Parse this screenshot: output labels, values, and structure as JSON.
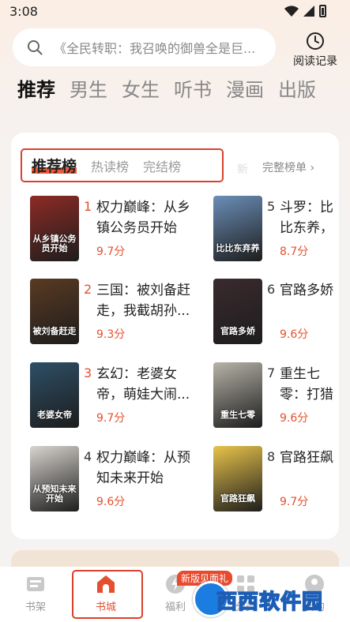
{
  "status": {
    "time": "3:08"
  },
  "search": {
    "text": "《全民转职：我召唤的御兽全是巨..."
  },
  "history": {
    "label": "阅读记录"
  },
  "categories": [
    "推荐",
    "男生",
    "女生",
    "听书",
    "漫画",
    "出版"
  ],
  "ranking": {
    "tabs": [
      "推荐榜",
      "热读榜",
      "完结榜"
    ],
    "full_list_label": "完整榜单",
    "books": [
      {
        "rank": "1",
        "title": "权力巅峰：从乡镇公务员开始",
        "score": "9.7分",
        "cover_text": "从乡镇公务员开始",
        "cover_color": "#8e2b25"
      },
      {
        "rank": "2",
        "title": "三国：被刘备赶走，我截胡孙...",
        "score": "9.3分",
        "cover_text": "被刘备赶走",
        "cover_color": "#5a3a22"
      },
      {
        "rank": "3",
        "title": "玄幻：老婆女帝，萌娃大闹...",
        "score": "9.7分",
        "cover_text": "老婆女帝",
        "cover_color": "#2e4f66"
      },
      {
        "rank": "4",
        "title": "权力巅峰：从预知未来开始",
        "score": "9.6分",
        "cover_text": "从预知未来开始",
        "cover_color": "#d8d4cf"
      },
      {
        "rank": "5",
        "title": "斗罗：比比东养，雪帝",
        "score": "8.7分",
        "cover_text": "比比东弃养",
        "cover_color": "#6b8fb8"
      },
      {
        "rank": "6",
        "title": "官路多娇",
        "score": "9.6分",
        "cover_text": "官路多娇",
        "cover_color": "#3a2a2e"
      },
      {
        "rank": "7",
        "title": "重生七零：打猎养家",
        "score": "9.6分",
        "cover_text": "重生七零",
        "cover_color": "#b7b3a8"
      },
      {
        "rank": "8",
        "title": "官路狂飙",
        "score": "9.7分",
        "cover_text": "官路狂飙",
        "cover_color": "#e8c34a"
      }
    ]
  },
  "nav": {
    "items": [
      {
        "label": "书架"
      },
      {
        "label": "书城"
      },
      {
        "label": "福利"
      },
      {
        "label": "分类"
      },
      {
        "label": "我的"
      }
    ],
    "badge": "新版见面礼"
  },
  "watermark": {
    "text": "西西软件园"
  },
  "colors": {
    "accent": "#e4502e",
    "highlight_box": "#d9412b"
  }
}
